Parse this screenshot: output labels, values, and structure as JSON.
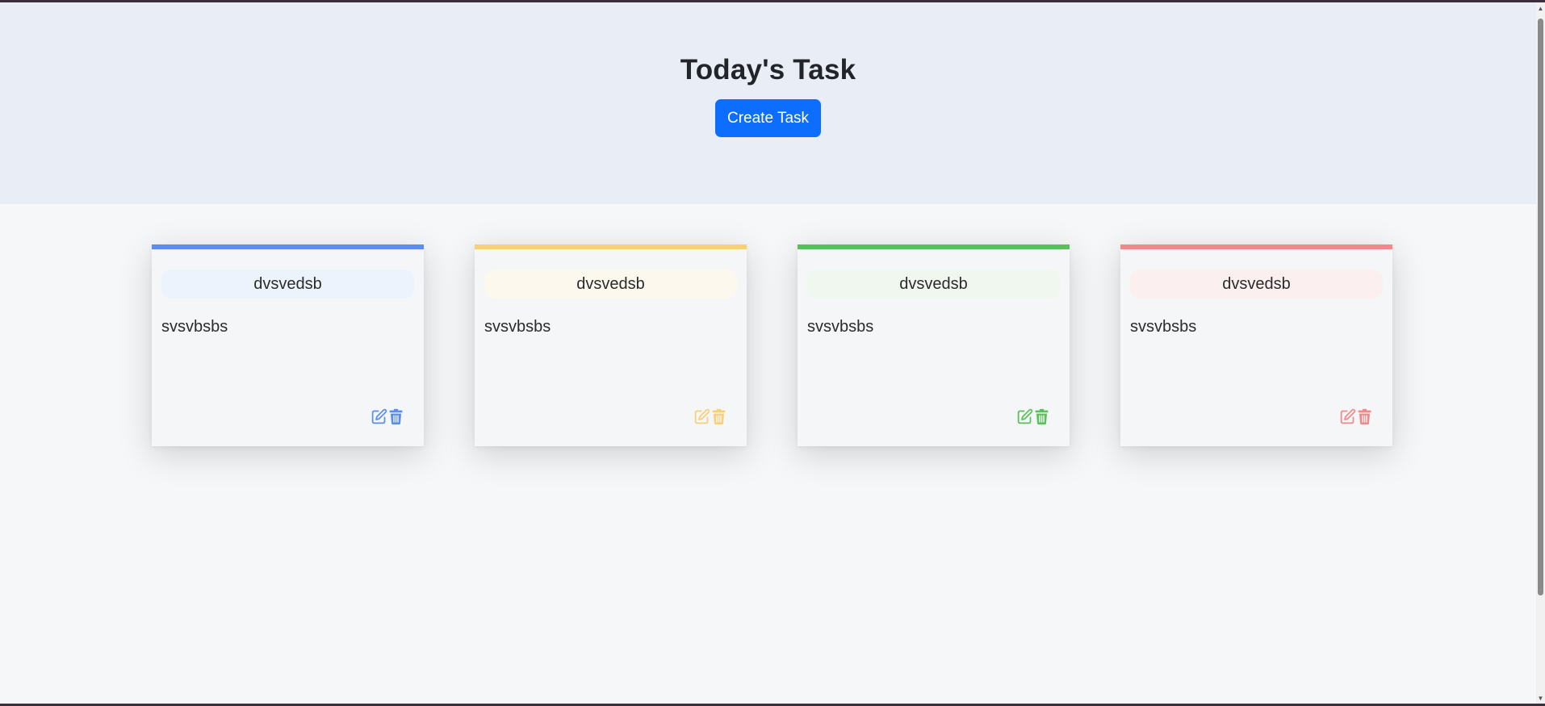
{
  "header": {
    "title": "Today's Task",
    "create_button_label": "Create Task"
  },
  "cards": [
    {
      "title": "dvsvedsb",
      "body": "svsvbsbs",
      "accent": "#5b8def",
      "tint": "#edf3fd"
    },
    {
      "title": "dvsvedsb",
      "body": "svsvbsbs",
      "accent": "#f7d078",
      "tint": "#fdf8ee"
    },
    {
      "title": "dvsvedsb",
      "body": "svsvbsbs",
      "accent": "#5cc05a",
      "tint": "#eff7ef"
    },
    {
      "title": "dvsvedsb",
      "body": "svsvbsbs",
      "accent": "#f08a8a",
      "tint": "#fcefef"
    }
  ],
  "icons": {
    "edit": "edit-icon",
    "delete": "trash-icon"
  }
}
